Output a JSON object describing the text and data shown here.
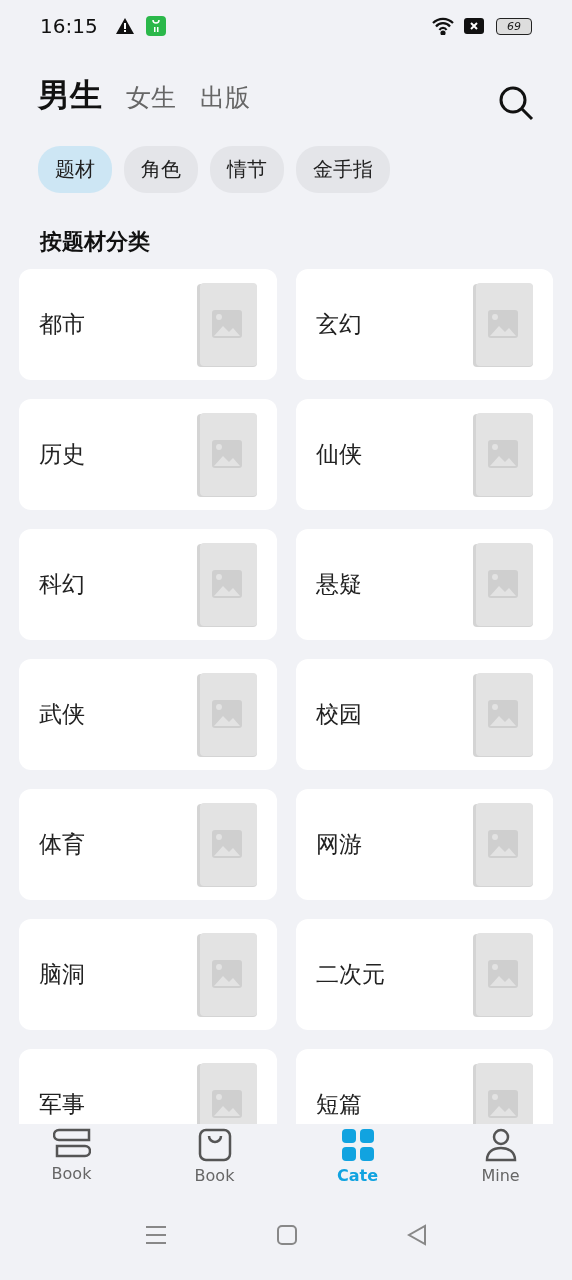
{
  "status_bar": {
    "time": "16:15",
    "battery": "69"
  },
  "header_tabs": [
    {
      "label": "男生",
      "selected": true
    },
    {
      "label": "女生",
      "selected": false
    },
    {
      "label": "出版",
      "selected": false
    }
  ],
  "filter_chips": [
    {
      "label": "题材",
      "selected": true
    },
    {
      "label": "角色",
      "selected": false
    },
    {
      "label": "情节",
      "selected": false
    },
    {
      "label": "金手指",
      "selected": false
    }
  ],
  "section_title": "按题材分类",
  "categories": [
    {
      "label": "都市"
    },
    {
      "label": "玄幻"
    },
    {
      "label": "历史"
    },
    {
      "label": "仙侠"
    },
    {
      "label": "科幻"
    },
    {
      "label": "悬疑"
    },
    {
      "label": "武侠"
    },
    {
      "label": "校园"
    },
    {
      "label": "体育"
    },
    {
      "label": "网游"
    },
    {
      "label": "脑洞"
    },
    {
      "label": "二次元"
    },
    {
      "label": "军事"
    },
    {
      "label": "短篇"
    }
  ],
  "bottom_nav": [
    {
      "label": "Book",
      "kind": "books",
      "selected": false
    },
    {
      "label": "Book",
      "kind": "bag",
      "selected": false
    },
    {
      "label": "Cate",
      "kind": "grid",
      "selected": true
    },
    {
      "label": "Mine",
      "kind": "person",
      "selected": false
    }
  ]
}
